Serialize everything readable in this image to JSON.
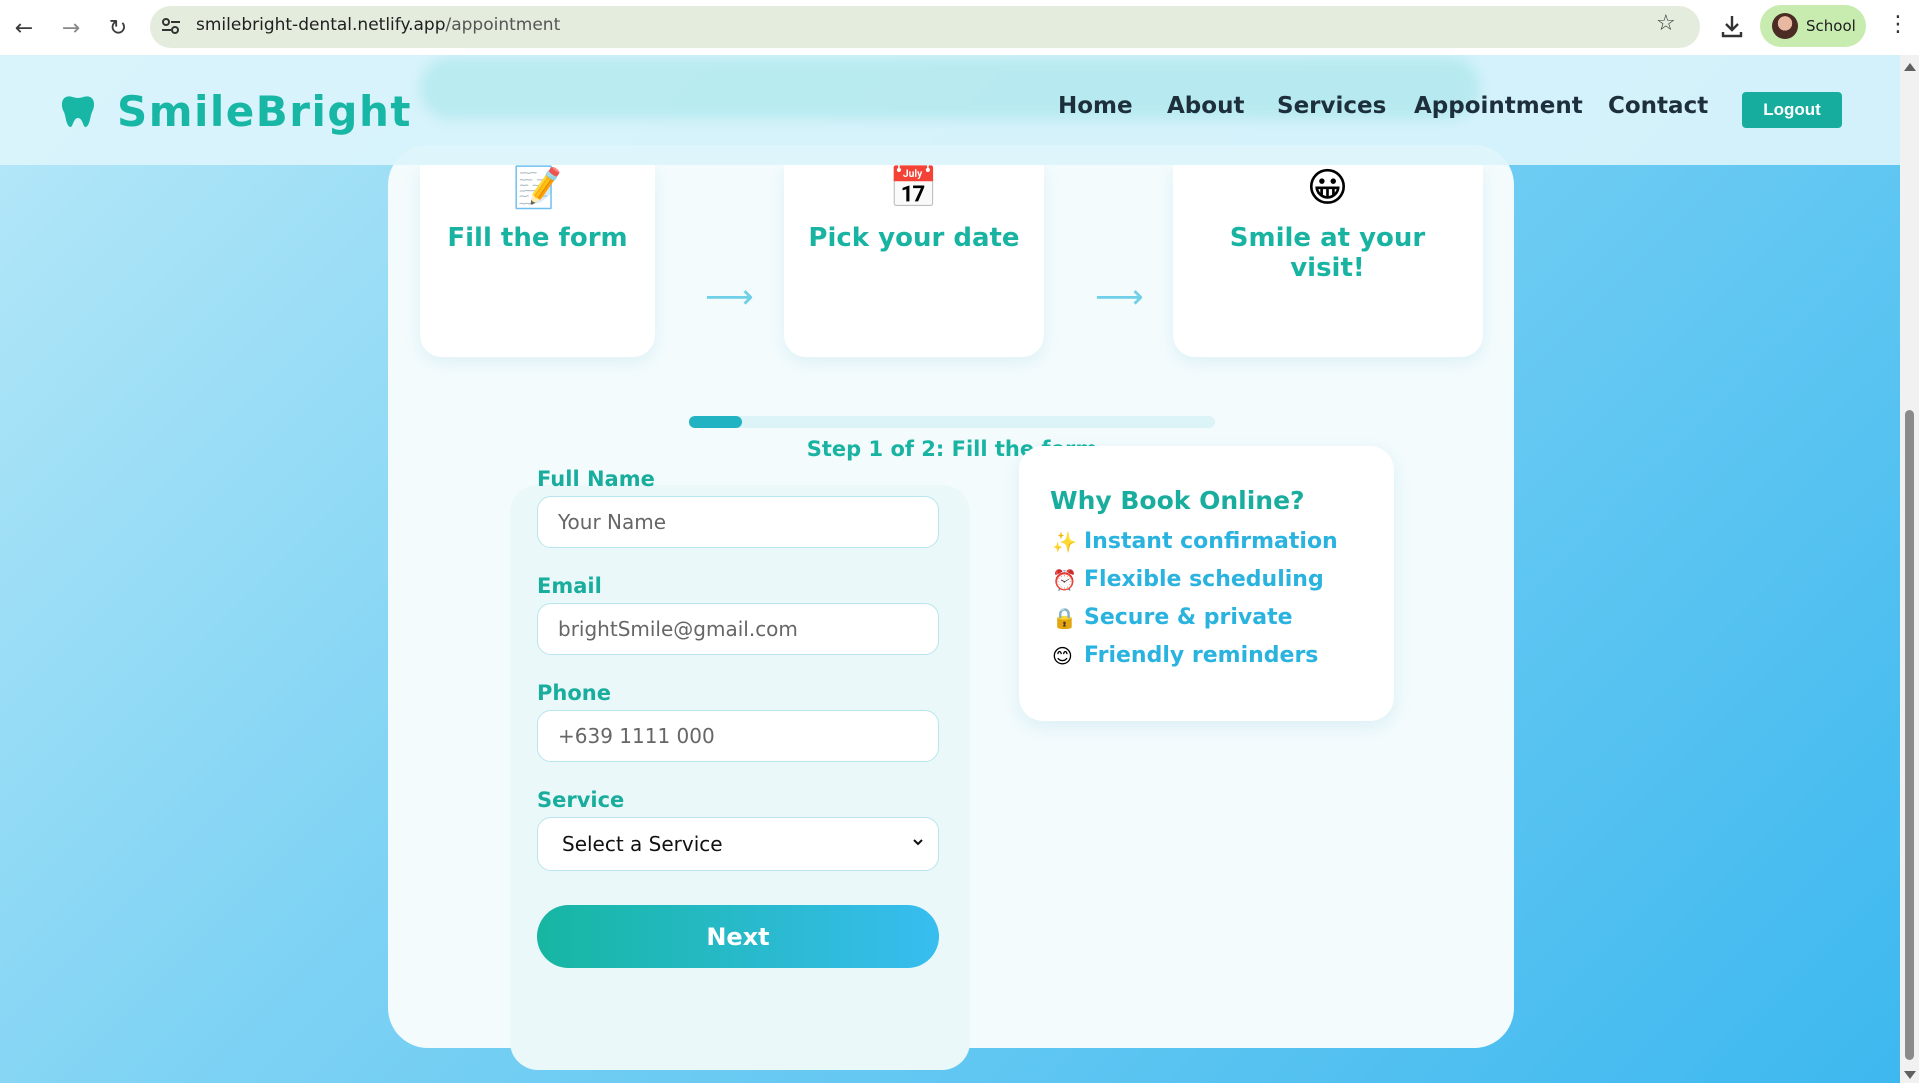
{
  "browser": {
    "url_host": "smilebright-dental.netlify.app",
    "url_path": "/appointment",
    "profile_label": "School"
  },
  "brand": {
    "name": "SmileBright"
  },
  "nav": {
    "items": [
      {
        "label": "Home"
      },
      {
        "label": "About"
      },
      {
        "label": "Services"
      },
      {
        "label": "Appointment"
      },
      {
        "label": "Contact"
      }
    ],
    "logout_label": "Logout"
  },
  "steps": [
    {
      "icon": "📝",
      "label": "Fill the form"
    },
    {
      "icon": "📅",
      "label": "Pick your date"
    },
    {
      "icon": "😀",
      "label": "Smile at your visit!"
    }
  ],
  "progress": {
    "fraction": 0.1,
    "text": "Step 1 of 2: Fill the form"
  },
  "form": {
    "full_name": {
      "label": "Full Name",
      "placeholder": "Your Name",
      "value": ""
    },
    "email": {
      "label": "Email",
      "placeholder": "brightSmile@gmail.com",
      "value": ""
    },
    "phone": {
      "label": "Phone",
      "placeholder": "+639 1111 000",
      "value": ""
    },
    "service": {
      "label": "Service",
      "selected": "Select a Service"
    },
    "next_label": "Next"
  },
  "why": {
    "title": "Why Book Online?",
    "items": [
      {
        "emoji": "✨",
        "text": "Instant confirmation"
      },
      {
        "emoji": "⏰",
        "text": "Flexible scheduling"
      },
      {
        "emoji": "🔒",
        "text": "Secure & private"
      },
      {
        "emoji": "😊",
        "text": "Friendly reminders"
      }
    ]
  },
  "colors": {
    "brand_teal": "#18b6a4",
    "accent_blue": "#2bb3e0",
    "logout_bg": "#17ad9e"
  }
}
